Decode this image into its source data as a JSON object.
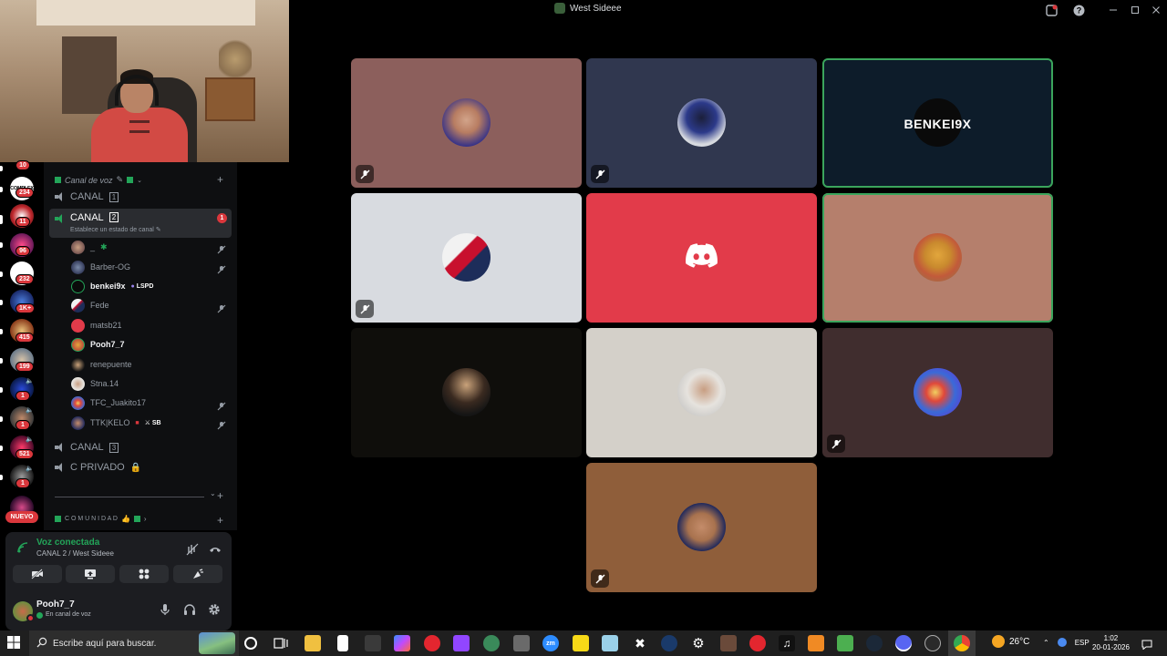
{
  "window": {
    "title": "West Sideee"
  },
  "servers": [
    {
      "badge": "10"
    },
    {
      "badge": "234",
      "label": "COMPLEX"
    },
    {
      "badge": "11"
    },
    {
      "badge": "96"
    },
    {
      "badge": "232"
    },
    {
      "badge": "1K+"
    },
    {
      "badge": "415"
    },
    {
      "badge": "199"
    },
    {
      "badge": "1"
    },
    {
      "badge": "1"
    },
    {
      "badge": "521"
    },
    {
      "badge": "1"
    }
  ],
  "new_badge": "NUEVO",
  "sidebar": {
    "category_voice": "Canal de voz",
    "category_other": "C O M U N I D A D",
    "channels": [
      {
        "name": "CANAL",
        "num": "1"
      },
      {
        "name": "CANAL",
        "num": "2",
        "status": "Establece un estado de canal",
        "badge": "1"
      },
      {
        "name": "CANAL",
        "num": "3"
      },
      {
        "name": "C PRIVADO"
      }
    ],
    "members": [
      {
        "name": "_"
      },
      {
        "name": "Barber-OG"
      },
      {
        "name": "benkei9x",
        "tag": "LSPD"
      },
      {
        "name": "Fede"
      },
      {
        "name": "matsb21"
      },
      {
        "name": "Pooh7_7"
      },
      {
        "name": "renepuente"
      },
      {
        "name": "Stna.14"
      },
      {
        "name": "TFC_Juakito17"
      },
      {
        "name": "TTK|KELO",
        "tag": "SB"
      }
    ]
  },
  "voice_panel": {
    "status": "Voz conectada",
    "location": "CANAL 2 / West Sideee"
  },
  "user_panel": {
    "name": "Pooh7_7",
    "sub": "En canal de voz"
  },
  "stage": {
    "benkei_text": "BENKEI9X"
  },
  "taskbar": {
    "search_placeholder": "Escribe aquí para buscar.",
    "weather": "26°C",
    "lang": "ESP",
    "time": "1:02",
    "date": "20-01-2026"
  },
  "colors": {
    "accent_green": "#23a559",
    "notify_red": "#da373c",
    "discord_red": "#e23b4a"
  }
}
